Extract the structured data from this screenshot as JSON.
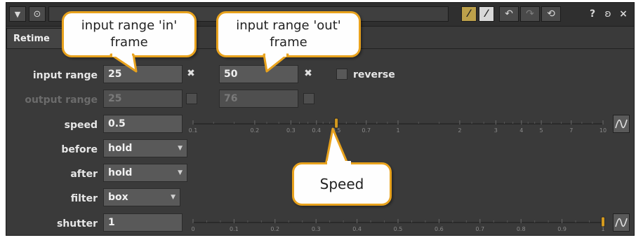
{
  "titlebar": {
    "collapse_icon": "triangle-down-icon",
    "node_icon": "circle-dot-icon",
    "right_icons": [
      "yellow-slash-icon",
      "white-slash-icon",
      "undo-icon",
      "redo-icon",
      "revert-icon",
      "help-icon",
      "float-icon",
      "close-icon"
    ],
    "help_glyph": "?",
    "float_glyph": "ʚ",
    "close_glyph": "×"
  },
  "tab": {
    "label": "Retime"
  },
  "rows": {
    "input_range": {
      "label": "input range",
      "in_value": "25",
      "out_value": "50",
      "reverse_label": "reverse"
    },
    "output_range": {
      "label": "output range",
      "in_value": "25",
      "out_value": "76"
    },
    "speed": {
      "label": "speed",
      "value": "0.5",
      "ticks": [
        "0.1",
        "0.2",
        "0.3",
        "0.4",
        "0.5",
        "0.7",
        "1",
        "2",
        "3",
        "4",
        "5",
        "7",
        "10"
      ],
      "position": 0.5
    },
    "before": {
      "label": "before",
      "value": "hold"
    },
    "after": {
      "label": "after",
      "value": "hold"
    },
    "filter": {
      "label": "filter",
      "value": "box"
    },
    "shutter": {
      "label": "shutter",
      "value": "1",
      "ticks": [
        "0",
        "0.1",
        "0.2",
        "0.3",
        "0.4",
        "0.5",
        "0.6",
        "0.7",
        "0.8",
        "0.9",
        "1"
      ],
      "position": 1
    }
  },
  "callouts": {
    "in_frame": [
      "input range 'in'",
      "frame"
    ],
    "out_frame": [
      "input range 'out'",
      "frame"
    ],
    "speed": "Speed"
  },
  "colors": {
    "accent": "#e8a21d",
    "slider_handle": "#d49a1e"
  }
}
